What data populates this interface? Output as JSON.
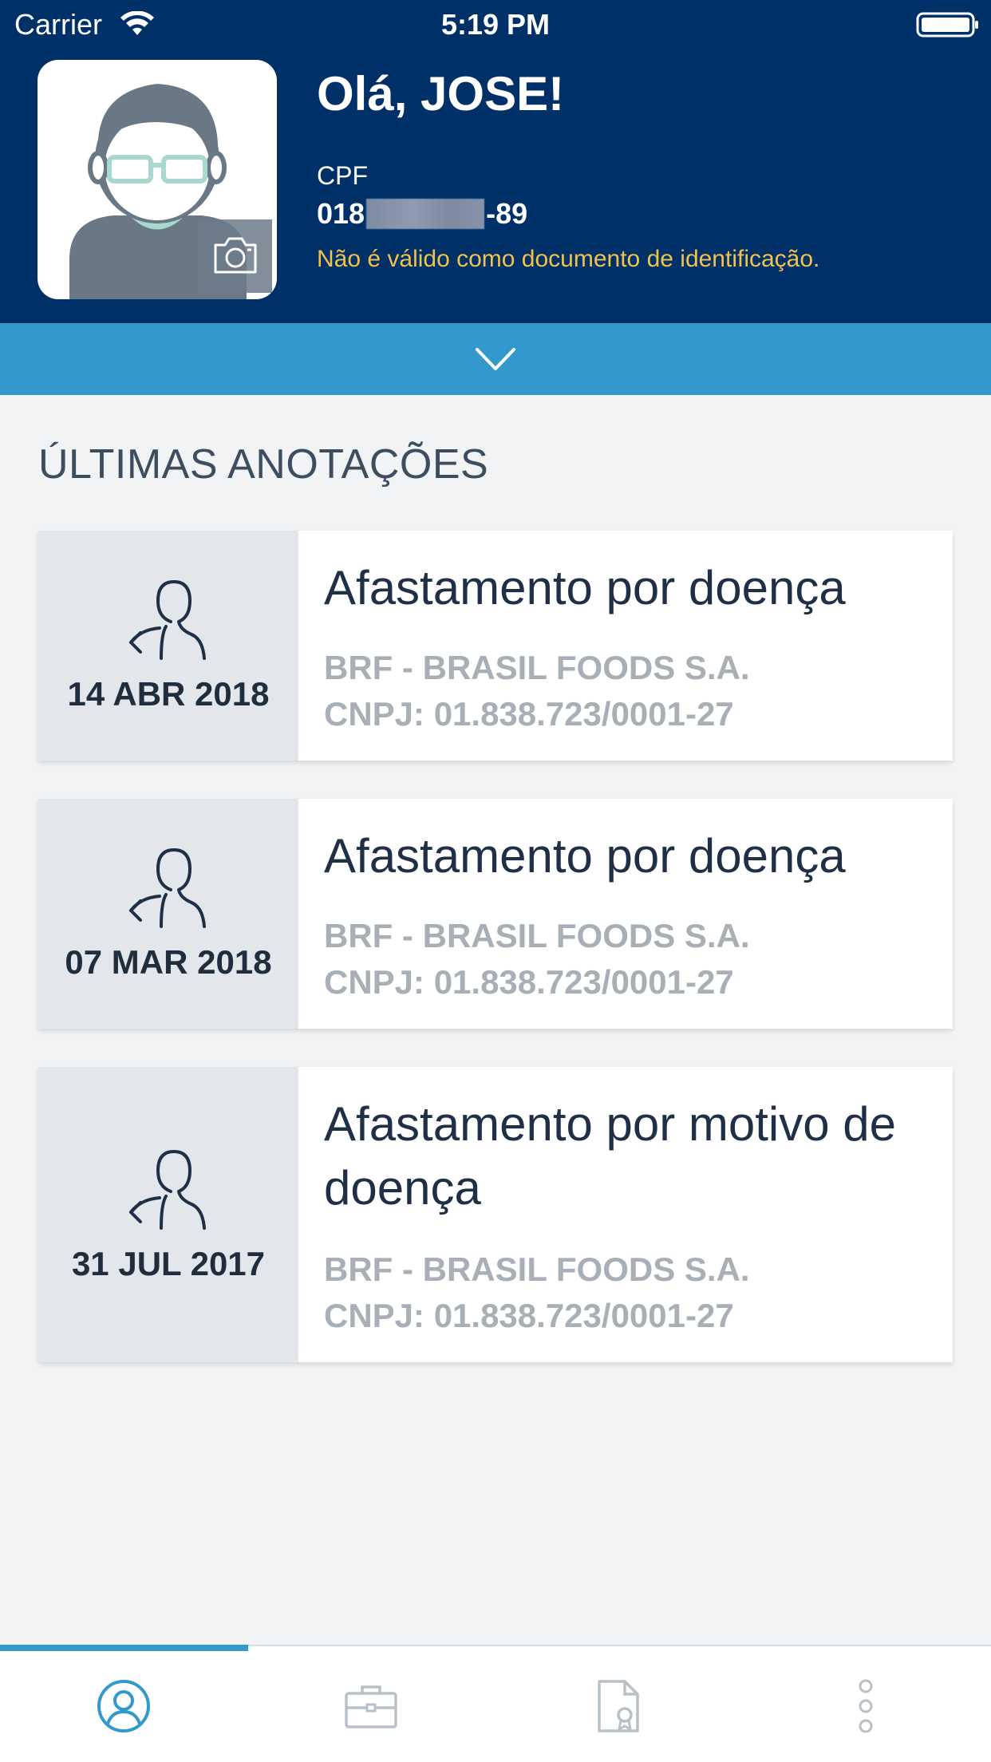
{
  "status_bar": {
    "carrier": "Carrier",
    "time": "5:19 PM"
  },
  "profile": {
    "greeting": "Olá, JOSE!",
    "cpf_label": "CPF",
    "cpf_prefix": "018",
    "cpf_suffix": "-89",
    "cpf_warning": "Não é válido como documento de identificação."
  },
  "section": {
    "title": "ÚLTIMAS ANOTAÇÕES"
  },
  "annotations": [
    {
      "date": "14 ABR 2018",
      "title": "Afastamento por doença",
      "company": "BRF - BRASIL FOODS S.A.",
      "cnpj": "CNPJ: 01.838.723/0001-27"
    },
    {
      "date": "07 MAR 2018",
      "title": "Afastamento por doença",
      "company": "BRF - BRASIL FOODS S.A.",
      "cnpj": "CNPJ: 01.838.723/0001-27"
    },
    {
      "date": "31 JUL 2017",
      "title": "Afastamento por motivo de doença",
      "company": "BRF - BRASIL FOODS S.A.",
      "cnpj": "CNPJ: 01.838.723/0001-27"
    }
  ],
  "tabs": [
    {
      "icon": "profile-icon",
      "active": true
    },
    {
      "icon": "briefcase-icon",
      "active": false
    },
    {
      "icon": "certificate-document-icon",
      "active": false
    },
    {
      "icon": "more-vertical-icon",
      "active": false
    }
  ],
  "colors": {
    "header_bg": "#003068",
    "accent": "#3399cc",
    "warning": "#f2c24a",
    "content_bg": "#f2f3f4"
  }
}
